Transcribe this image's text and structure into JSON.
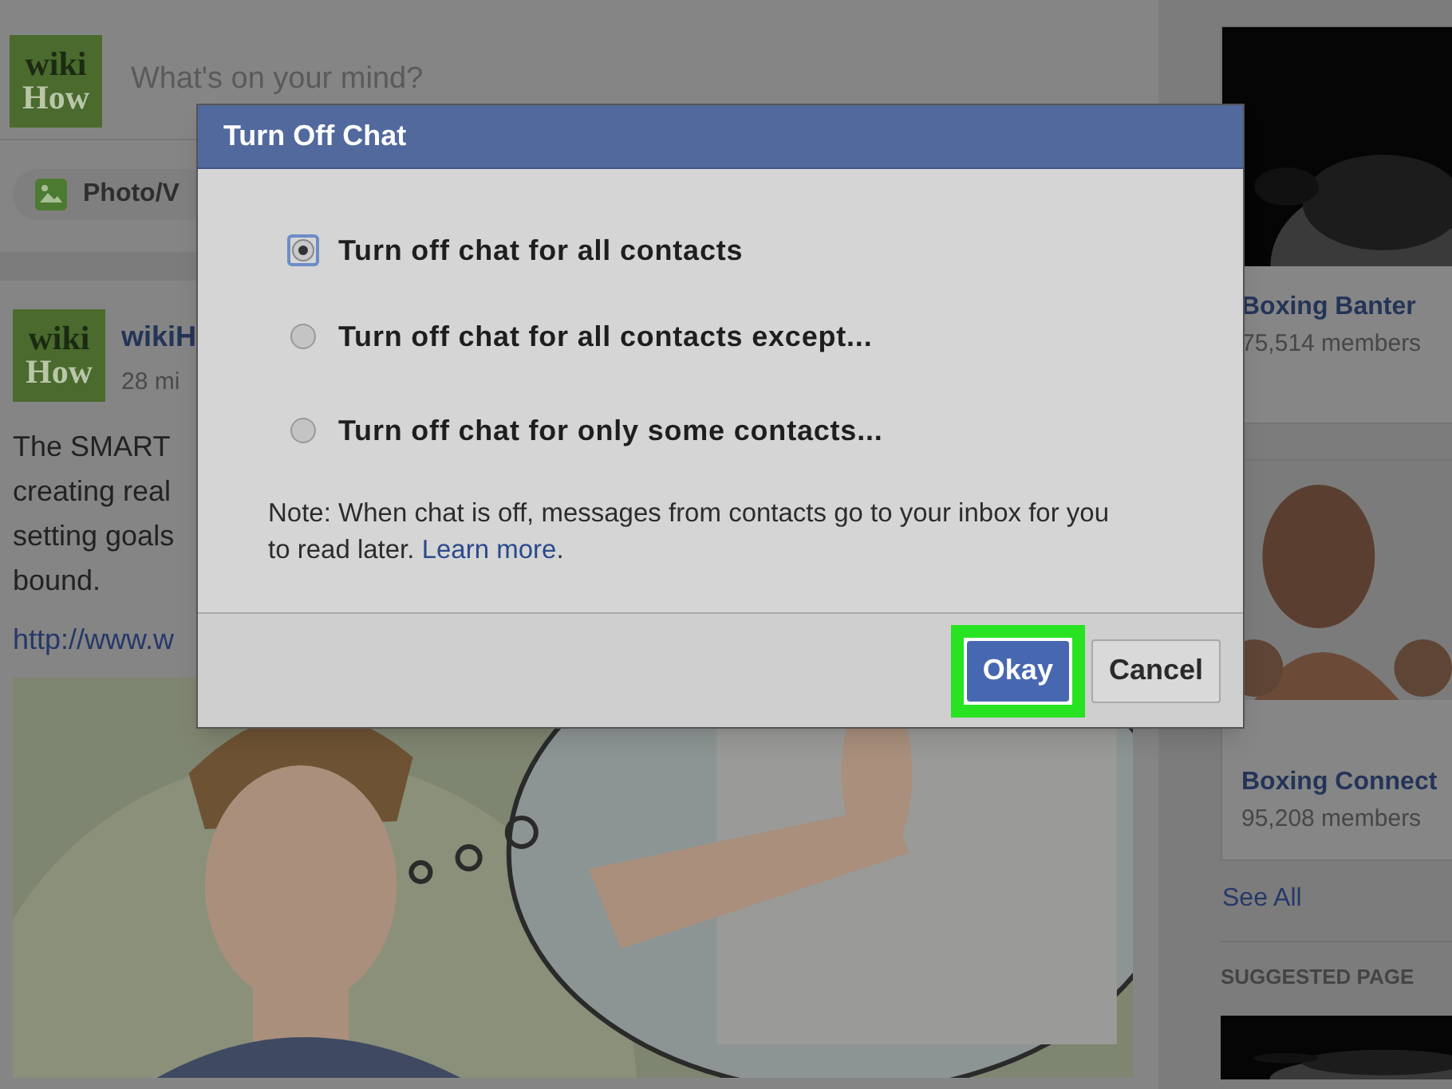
{
  "composer": {
    "logo": [
      "wiki",
      "How"
    ],
    "placeholder": "What's on your mind?",
    "photo_button": "Photo/V"
  },
  "post": {
    "logo": [
      "wiki",
      "How"
    ],
    "author": "wikiH",
    "time": "28 mi",
    "lines": [
      "The SMART",
      "creating real",
      "setting goals",
      "bound."
    ],
    "link": "http://www.w"
  },
  "groups": [
    {
      "name": "Boxing Banter",
      "members": "75,514 members"
    },
    {
      "name": "Boxing Connect",
      "members": "95,208 members"
    }
  ],
  "see_all": "See All",
  "suggested_heading": "SUGGESTED PAGE",
  "dialog": {
    "title": "Turn Off Chat",
    "options": [
      {
        "label": "Turn off chat for all contacts",
        "selected": true
      },
      {
        "label": "Turn off chat for all contacts except...",
        "selected": false
      },
      {
        "label": "Turn off chat for only some contacts...",
        "selected": false
      }
    ],
    "note": "Note: When chat is off, messages from contacts go to your inbox for you to read later.",
    "note_link": "Learn more",
    "note_end": ".",
    "buttons": [
      {
        "label": "Okay",
        "kind": "primary",
        "highlighted": true
      },
      {
        "label": "Cancel",
        "kind": "secondary",
        "highlighted": false
      }
    ]
  }
}
